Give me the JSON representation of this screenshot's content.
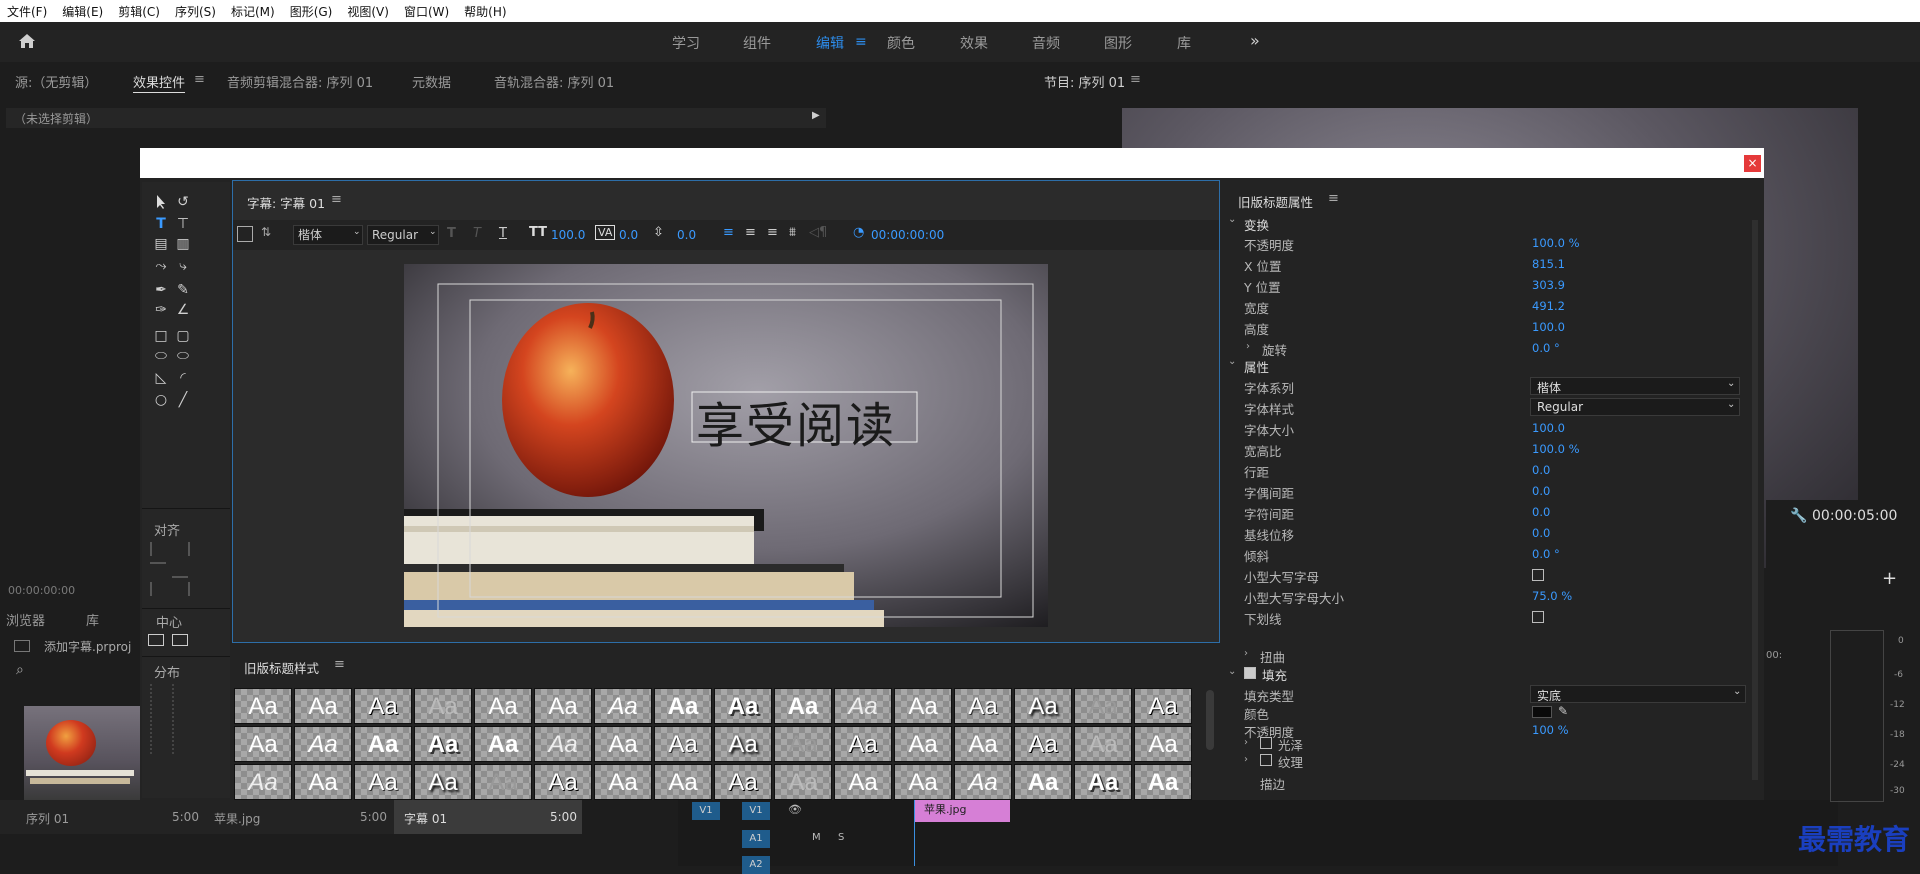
{
  "menu": [
    "文件(F)",
    "编辑(E)",
    "剪辑(C)",
    "序列(S)",
    "标记(M)",
    "图形(G)",
    "视图(V)",
    "窗口(W)",
    "帮助(H)"
  ],
  "workspace_tabs": [
    "学习",
    "组件",
    "编辑",
    "颜色",
    "效果",
    "音频",
    "图形",
    "库"
  ],
  "workspace_active": "编辑",
  "source_panel": {
    "tabs": [
      "源:（无剪辑）",
      "效果控件",
      "音频剪辑混合器: 序列 01",
      "元数据",
      "音轨混合器: 序列 01"
    ],
    "no_clip": "（未选择剪辑）",
    "timecode": "00:00:00:00"
  },
  "program_panel": {
    "title": "节目: 序列 01",
    "timecode": "00:00:05:00"
  },
  "project_panel": {
    "tabs": [
      "浏览器",
      "库"
    ],
    "project_name": "添加字幕.prproj"
  },
  "titler": {
    "tools_sections": [
      "对齐",
      "中心",
      "分布"
    ],
    "editor_title": "字幕: 字幕 01",
    "toolbar": {
      "font": "楷体",
      "style": "Regular",
      "size": "100.0",
      "kerning": "0.0",
      "leading": "0.0",
      "timecode": "00:00:00:00"
    },
    "canvas_text": "享受阅读",
    "styles_title": "旧版标题样式",
    "style_swatch_label": "Aa"
  },
  "properties": {
    "title": "旧版标题属性",
    "sections": {
      "transform": "变换",
      "properties": "属性",
      "fill": "填充"
    },
    "rows": [
      {
        "label": "不透明度",
        "value": "100.0 %"
      },
      {
        "label": "X 位置",
        "value": "815.1"
      },
      {
        "label": "Y 位置",
        "value": "303.9"
      },
      {
        "label": "宽度",
        "value": "491.2"
      },
      {
        "label": "高度",
        "value": "100.0"
      },
      {
        "label": "旋转",
        "value": "0.0 °"
      }
    ],
    "prop_rows": [
      {
        "label": "字体系列",
        "value": "楷体"
      },
      {
        "label": "字体样式",
        "value": "Regular"
      },
      {
        "label": "字体大小",
        "value": "100.0"
      },
      {
        "label": "宽高比",
        "value": "100.0 %"
      },
      {
        "label": "行距",
        "value": "0.0"
      },
      {
        "label": "字偶间距",
        "value": "0.0"
      },
      {
        "label": "字符间距",
        "value": "0.0"
      },
      {
        "label": "基线位移",
        "value": "0.0"
      },
      {
        "label": "倾斜",
        "value": "0.0 °"
      },
      {
        "label": "小型大写字母",
        "value": ""
      },
      {
        "label": "小型大写字母大小",
        "value": "75.0 %"
      },
      {
        "label": "下划线",
        "value": ""
      }
    ],
    "distort": "扭曲",
    "fill_rows": [
      {
        "label": "填充类型",
        "value": "实底"
      },
      {
        "label": "颜色",
        "value": ""
      },
      {
        "label": "不透明度",
        "value": "100 %"
      }
    ],
    "sheen": "光泽",
    "texture": "纹理",
    "stroke_partial": "描边"
  },
  "bottom": {
    "clips": [
      {
        "name": "序列 01",
        "duration": "5:00"
      },
      {
        "name": "苹果.jpg",
        "duration": "5:00"
      },
      {
        "name": "字幕 01",
        "duration": "5:00"
      }
    ],
    "tracks": [
      "V1",
      "A1",
      "A2"
    ],
    "clip_on_timeline": "苹果.jpg",
    "meter_ticks": [
      "0",
      "-6",
      "-12",
      "-18",
      "-24",
      "-30"
    ],
    "meter_db": "00:"
  },
  "watermark": "最需教育",
  "colors": {
    "accent": "#2d8ceb",
    "close": "#e5393a",
    "clip_pink": "#d67fd6"
  }
}
